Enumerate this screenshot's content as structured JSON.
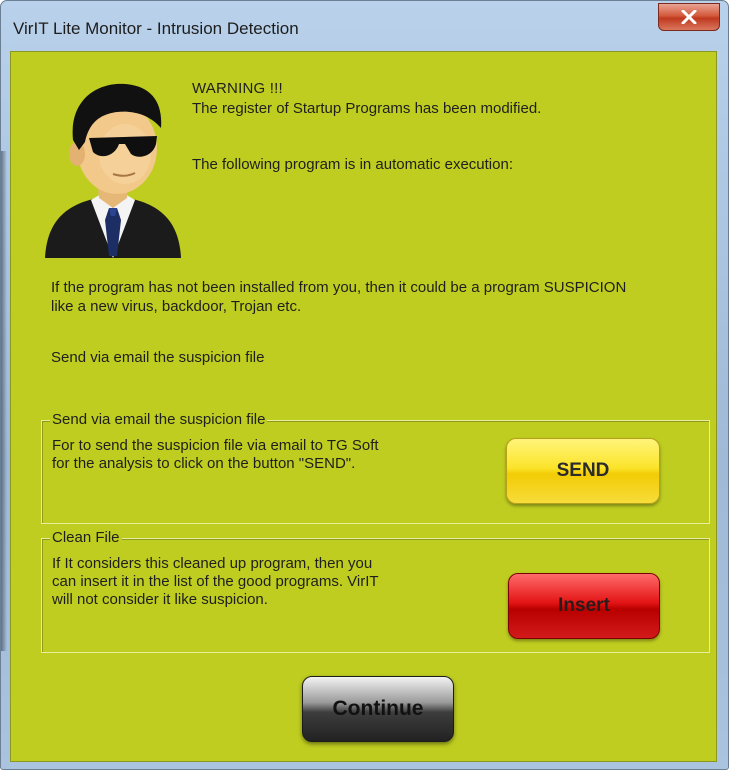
{
  "window": {
    "title": "VirIT Lite Monitor - Intrusion Detection",
    "close_icon": "close-icon"
  },
  "header": {
    "avatar_icon": "agent-avatar-icon",
    "warning_title": "WARNING !!!",
    "warning_line1": "The register of Startup Programs has been modified.",
    "warning_line2": "The following program is in automatic execution:"
  },
  "body": {
    "para1_line1": "If the program has not been installed from you, then it could be a program SUSPICION",
    "para1_line2": "like a new virus, backdoor, Trojan etc.",
    "para2": "Send via email the suspicion file"
  },
  "send_group": {
    "legend": "Send via email the suspicion file",
    "text_line1": "For to send the suspicion file via email to TG Soft",
    "text_line2": "for the analysis to click on the button \"SEND\".",
    "button_label": "SEND"
  },
  "clean_group": {
    "legend": "Clean File",
    "text_line1": "If It considers this cleaned up program, then you",
    "text_line2": "can insert it in the list of the good programs.  VirIT",
    "text_line3": "will not consider it like suspicion.",
    "button_label": "Insert"
  },
  "footer": {
    "continue_label": "Continue"
  },
  "colors": {
    "client_bg": "#bfcd20",
    "send_button": "#fbe42a",
    "insert_button": "#e31414",
    "continue_button": "#3d3d3d",
    "close_button": "#c0391f"
  }
}
